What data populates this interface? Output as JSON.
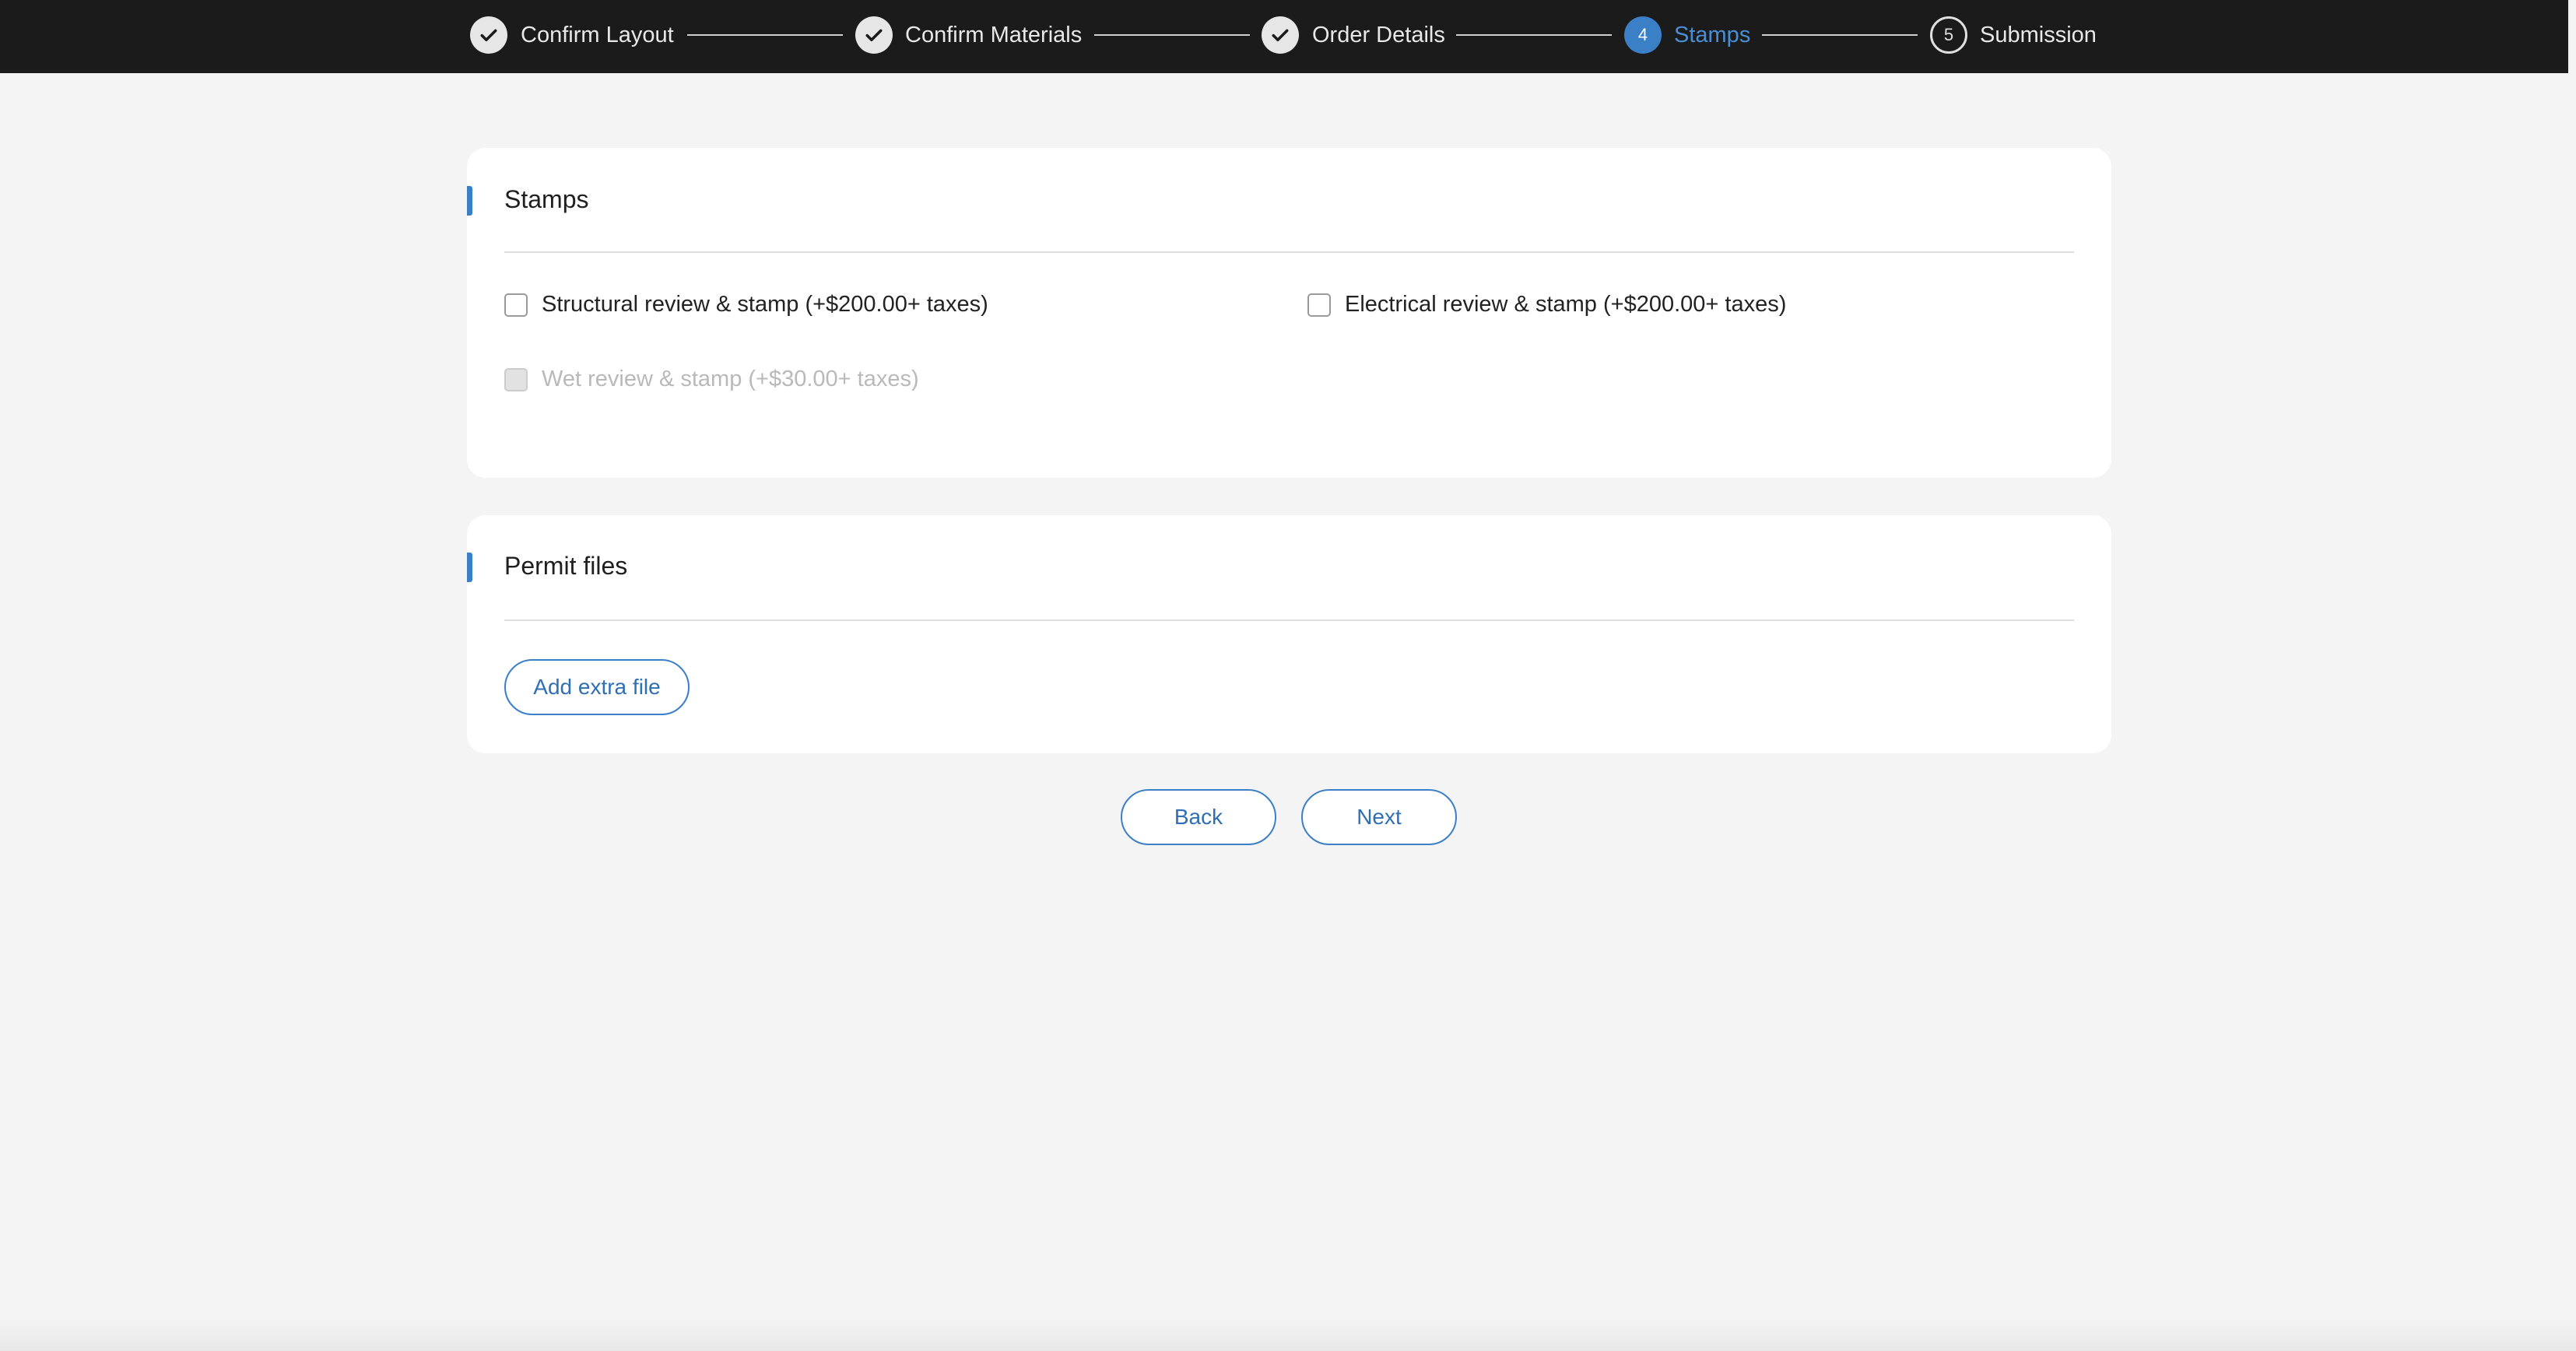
{
  "stepper": {
    "steps": [
      {
        "label": "Confirm Layout",
        "status": "completed"
      },
      {
        "label": "Confirm Materials",
        "status": "completed"
      },
      {
        "label": "Order Details",
        "status": "completed"
      },
      {
        "label": "Stamps",
        "number": "4",
        "status": "active"
      },
      {
        "label": "Submission",
        "number": "5",
        "status": "pending"
      }
    ]
  },
  "stamps_section": {
    "title": "Stamps",
    "options": [
      {
        "label": "Structural review & stamp (+$200.00+ taxes)",
        "checked": false,
        "disabled": false
      },
      {
        "label": "Electrical review & stamp (+$200.00+ taxes)",
        "checked": false,
        "disabled": false
      },
      {
        "label": "Wet review & stamp (+$30.00+ taxes)",
        "checked": false,
        "disabled": true
      }
    ]
  },
  "permit_section": {
    "title": "Permit files",
    "add_file_label": "Add extra file"
  },
  "navigation": {
    "back_label": "Back",
    "next_label": "Next"
  },
  "colors": {
    "accent": "#3b7fc7",
    "header_background": "#1b1b1b",
    "page_background": "#f4f4f4"
  }
}
